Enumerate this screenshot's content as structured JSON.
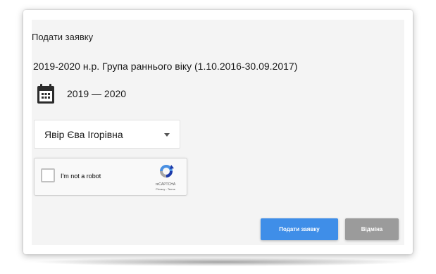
{
  "form": {
    "title": "Подати заявку",
    "group_text": "2019-2020 н.р. Група раннього віку (1.10.2016-30.09.2017)",
    "date_range": "2019 — 2020",
    "child_select": {
      "selected": "Явір Єва Ігорівна"
    }
  },
  "captcha": {
    "label": "I'm not a robot",
    "brand": "reCAPTCHA",
    "links": "Privacy - Terms"
  },
  "buttons": {
    "submit": "Подати заявку",
    "cancel": "Відміна"
  },
  "colors": {
    "submit_bg": "#3f8ee8",
    "cancel_bg": "#9b9b9b",
    "panel_bg": "#f4f4f4"
  },
  "icons": {
    "date": "calendar-icon",
    "select": "chevron-down-icon",
    "captcha": "recaptcha-logo-icon"
  }
}
